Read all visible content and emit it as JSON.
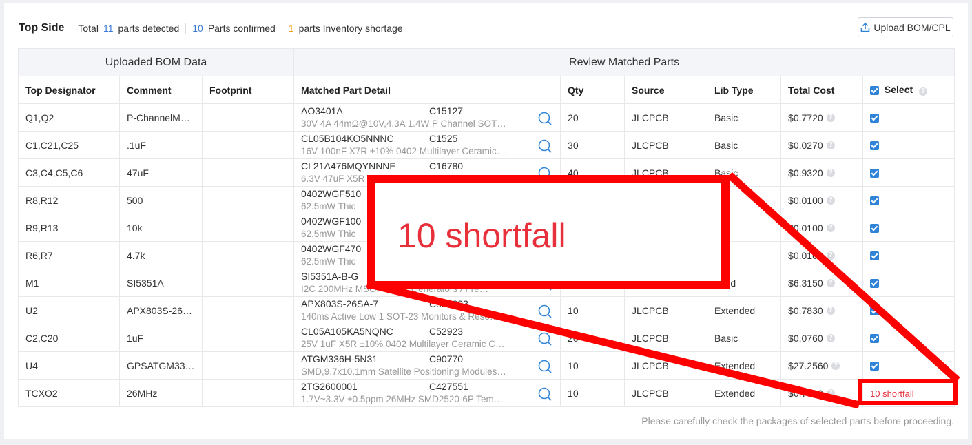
{
  "header": {
    "title": "Top Side",
    "total_label": "Total",
    "total_count": "11",
    "detected_label": "parts detected",
    "confirmed_count": "10",
    "confirmed_label": "Parts confirmed",
    "shortage_count": "1",
    "shortage_label": "parts Inventory shortage",
    "upload_label": "Upload BOM/CPL"
  },
  "groups": {
    "uploaded": "Uploaded BOM Data",
    "review": "Review Matched Parts"
  },
  "columns": {
    "designator": "Top Designator",
    "comment": "Comment",
    "footprint": "Footprint",
    "matched": "Matched Part Detail",
    "qty": "Qty",
    "source": "Source",
    "libtype": "Lib Type",
    "cost": "Total Cost",
    "select": "Select"
  },
  "rows": [
    {
      "designator": "Q1,Q2",
      "comment": "P-ChannelM…",
      "footprint": "",
      "mpn": "AO3401A",
      "lcsc": "C15127",
      "desc": "30V 4A 44mΩ@10V,4.3A 1.4W P Channel SOT…",
      "qty": "20",
      "source": "JLCPCB",
      "libtype": "Basic",
      "cost": "$0.7720",
      "select": "check"
    },
    {
      "designator": "C1,C21,C25",
      "comment": ".1uF",
      "footprint": "",
      "mpn": "CL05B104KO5NNNC",
      "lcsc": "C1525",
      "desc": "16V 100nF X7R ±10% 0402 Multilayer Ceramic…",
      "qty": "30",
      "source": "JLCPCB",
      "libtype": "Basic",
      "cost": "$0.0270",
      "select": "check"
    },
    {
      "designator": "C3,C4,C5,C6",
      "comment": "47uF",
      "footprint": "",
      "mpn": "CL21A476MQYNNNE",
      "lcsc": "C16780",
      "desc": "6.3V 47uF X5R",
      "qty": "40",
      "source": "JLCPCB",
      "libtype": "Basic",
      "cost": "$0.9320",
      "select": "check"
    },
    {
      "designator": "R8,R12",
      "comment": "500",
      "footprint": "",
      "mpn": "0402WGF510",
      "lcsc": "",
      "desc": "62.5mW Thic",
      "qty": "",
      "source": "",
      "libtype": "c",
      "cost": "$0.0100",
      "select": "check"
    },
    {
      "designator": "R9,R13",
      "comment": "10k",
      "footprint": "",
      "mpn": "0402WGF100",
      "lcsc": "",
      "desc": "62.5mW Thic",
      "qty": "",
      "source": "",
      "libtype": "c",
      "cost": "$0.0100",
      "select": "check"
    },
    {
      "designator": "R6,R7",
      "comment": "4.7k",
      "footprint": "",
      "mpn": "0402WGF470",
      "lcsc": "",
      "desc": "62.5mW Thic",
      "qty": "",
      "source": "",
      "libtype": "c",
      "cost": "$0.0100",
      "select": "check"
    },
    {
      "designator": "M1",
      "comment": "SI5351A",
      "footprint": "",
      "mpn": "SI5351A-B-G",
      "lcsc": "",
      "desc": "I2C 200MHz MSOP Clock Generators / Fre…",
      "qty": "",
      "source": "",
      "libtype": "nded",
      "cost": "$6.3150",
      "select": "check"
    },
    {
      "designator": "U2",
      "comment": "APX803S-26…",
      "footprint": "",
      "mpn": "APX803S-26SA-7",
      "lcsc": "C526893",
      "desc": "140ms Active Low 1 SOT-23 Monitors & Rese…",
      "qty": "10",
      "source": "JLCPCB",
      "libtype": "Extended",
      "cost": "$0.7830",
      "select": "check"
    },
    {
      "designator": "C2,C20",
      "comment": "1uF",
      "footprint": "",
      "mpn": "CL05A105KA5NQNC",
      "lcsc": "C52923",
      "desc": "25V 1uF X5R ±10% 0402 Multilayer Ceramic C…",
      "qty": "20",
      "source": "JLCPCB",
      "libtype": "Basic",
      "cost": "$0.0760",
      "select": "check"
    },
    {
      "designator": "U4",
      "comment": "GPSATGM33…",
      "footprint": "",
      "mpn": "ATGM336H-5N31",
      "lcsc": "C90770",
      "desc": "SMD,9.7x10.1mm Satellite Positioning Modules…",
      "qty": "10",
      "source": "JLCPCB",
      "libtype": "Extended",
      "cost": "$27.2560",
      "select": "check"
    },
    {
      "designator": "TCXO2",
      "comment": "26MHz",
      "footprint": "",
      "mpn": "2TG2600001",
      "lcsc": "C427551",
      "desc": "1.7V~3.3V ±0.5ppm 26MHz SMD2520-6P Tem…",
      "qty": "10",
      "source": "JLCPCB",
      "libtype": "Extended",
      "cost": "$0.7730",
      "select": "10 shortfall"
    }
  ],
  "footnote": "Please carefully check the packages of selected parts before proceeding.",
  "annotation": {
    "zoom_text": "10 shortfall",
    "color": "#ff0000"
  }
}
